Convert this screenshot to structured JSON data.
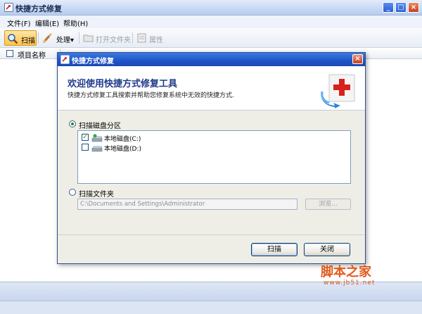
{
  "window": {
    "title": "快捷方式修复",
    "buttons": {
      "minimize": "_",
      "maximize": "□",
      "close": "×"
    }
  },
  "menu": {
    "items": [
      "文件(F)",
      "编辑(E)",
      "帮助(H)"
    ]
  },
  "toolbar": {
    "scan": "扫描",
    "process": "处理▾",
    "open_folder": "打开文件夹",
    "properties": "属性"
  },
  "list": {
    "column_name": "项目名称"
  },
  "dialog": {
    "title": "快捷方式修复",
    "close": "×",
    "banner_title": "欢迎使用快捷方式修复工具",
    "banner_desc": "快捷方式修复工具搜索并帮助您修复系统中无效的快捷方式.",
    "option_partition": "扫描磁盘分区",
    "drives": [
      {
        "label": "本地磁盘(C:)",
        "checked": true
      },
      {
        "label": "本地磁盘(D:)",
        "checked": false
      }
    ],
    "option_folder": "扫描文件夹",
    "folder_path": "C:\\Documents and Settings\\Administrator",
    "browse": "浏览...",
    "scan_button": "扫描",
    "close_button": "关闭"
  },
  "watermark": {
    "main": "脚本之家",
    "url": "www.jb51.net"
  },
  "colors": {
    "dialog_title": "#1e54c8",
    "banner_title": "#1f3a8a",
    "watermark": "#e05a1a",
    "toolbar_active": "#ffc34a"
  }
}
